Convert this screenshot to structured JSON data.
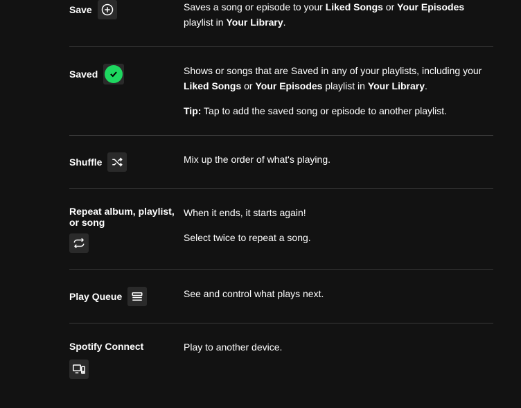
{
  "rows": [
    {
      "label": "Save",
      "icon": "plus-circle-icon",
      "layout": "inline",
      "desc_html": "Saves a song or episode to your <b>Liked Songs</b> or <b>Your Episodes</b> playlist in <b>Your Library</b>."
    },
    {
      "label": "Saved",
      "icon": "check-circle-green-icon",
      "layout": "inline",
      "desc_html": "Shows or songs that are Saved in any of your playlists, including your <b>Liked Songs</b> or <b>Your Episodes</b> playlist in <b>Your Library</b>.",
      "desc2_html": "<b>Tip:</b> Tap to add the saved song or episode to another playlist."
    },
    {
      "label": "Shuffle",
      "icon": "shuffle-icon",
      "layout": "inline",
      "desc_html": "Mix up the order of what's playing."
    },
    {
      "label": "Repeat album, playlist, or song",
      "icon": "repeat-icon",
      "layout": "inline-wrap",
      "desc_html": "When it ends, it starts again!",
      "desc2_html": "Select twice to repeat a song."
    },
    {
      "label": "Play Queue",
      "icon": "queue-icon",
      "layout": "inline",
      "desc_html": "See and control what plays next."
    },
    {
      "label": "Spotify Connect",
      "icon": "connect-icon",
      "layout": "stack",
      "desc_html": "Play to another device."
    }
  ]
}
